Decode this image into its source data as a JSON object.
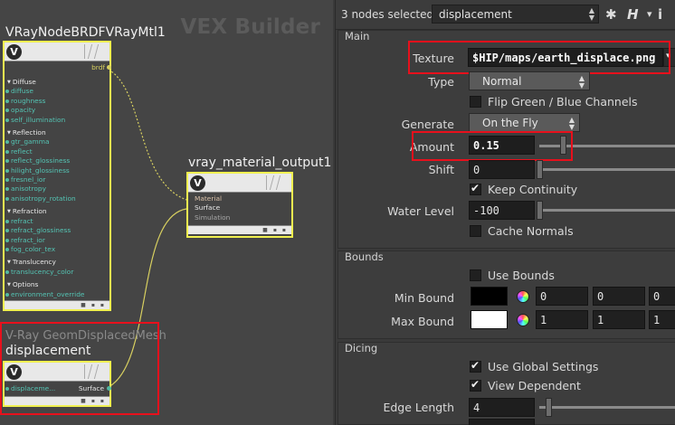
{
  "network": {
    "title": "VEX Builder",
    "nodes": {
      "mtl": {
        "label": "VRayNodeBRDFVRayMtl1",
        "output": "brdf",
        "sections": [
          {
            "name": "Diffuse",
            "inputs": [
              "diffuse",
              "roughness",
              "opacity",
              "self_illumination"
            ]
          },
          {
            "name": "Reflection",
            "inputs": [
              "gtr_gamma",
              "reflect",
              "reflect_glossiness",
              "hilight_glossiness",
              "fresnel_ior",
              "anisotropy",
              "anisotropy_rotation"
            ]
          },
          {
            "name": "Refraction",
            "inputs": [
              "refract",
              "refract_glossiness",
              "refract_ior",
              "fog_color_tex"
            ]
          },
          {
            "name": "Translucency",
            "inputs": [
              "translucency_color"
            ]
          },
          {
            "name": "Options",
            "inputs": [
              "environment_override"
            ]
          }
        ]
      },
      "output": {
        "label": "vray_material_output1",
        "inputs": [
          "Material",
          "Surface",
          "Simulation"
        ]
      },
      "disp": {
        "type_label": "V-Ray GeomDisplacedMesh",
        "label": "displacement",
        "input": "displaceme...",
        "output": "Surface"
      }
    }
  },
  "pane": {
    "selection_text": "3 nodes selected:",
    "selected_node": "displacement",
    "icons": [
      "gear-icon",
      "help-icon",
      "info-icon"
    ],
    "main": {
      "title": "Main",
      "texture_label": "Texture",
      "texture_value": "$HIP/maps/earth_displace.png",
      "type_label": "Type",
      "type_value": "Normal",
      "flip_label": "Flip Green / Blue Channels",
      "generate_label": "Generate",
      "generate_value": "On the Fly",
      "amount_label": "Amount",
      "amount_value": "0.15",
      "shift_label": "Shift",
      "shift_value": "0",
      "keep_label": "Keep Continuity",
      "water_label": "Water Level",
      "water_value": "-100",
      "cache_label": "Cache Normals"
    },
    "bounds": {
      "title": "Bounds",
      "use_label": "Use Bounds",
      "min_label": "Min Bound",
      "min_values": [
        "0",
        "0",
        "0"
      ],
      "max_label": "Max Bound",
      "max_values": [
        "1",
        "1",
        "1"
      ]
    },
    "dicing": {
      "title": "Dicing",
      "global_label": "Use Global Settings",
      "view_label": "View Dependent",
      "edge_label": "Edge Length",
      "edge_value": "4"
    },
    "colors": {
      "highlight": "#e8101c",
      "node_border": "#f0f050",
      "input_text": "#54c4b4"
    }
  }
}
